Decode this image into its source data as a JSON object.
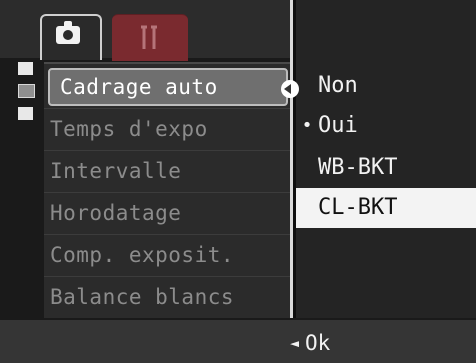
{
  "tabs": [
    {
      "icon": "camera-icon",
      "active": true
    },
    {
      "icon": "wrench-icon",
      "active": false
    }
  ],
  "menu": {
    "items": [
      {
        "label": "Cadrage auto",
        "selected": true
      },
      {
        "label": "Temps d'expo",
        "selected": false
      },
      {
        "label": "Intervalle",
        "selected": false
      },
      {
        "label": "Horodatage",
        "selected": false
      },
      {
        "label": "Comp. exposit.",
        "selected": false
      },
      {
        "label": "Balance blancs",
        "selected": false
      }
    ]
  },
  "submenu": {
    "items": [
      {
        "label": "Non",
        "marker": ""
      },
      {
        "label": "Oui",
        "marker": "•"
      },
      {
        "label": "WB-BKT",
        "marker": ""
      },
      {
        "label": "CL-BKT",
        "marker": ""
      }
    ],
    "highlighted_index": 3
  },
  "footer": {
    "hint": "Ok",
    "hint_arrow": "◄"
  },
  "colors": {
    "screen_bg": "#1a1a1a",
    "setup_tab": "#7a2a2f",
    "highlight": "#f3f3f3"
  }
}
